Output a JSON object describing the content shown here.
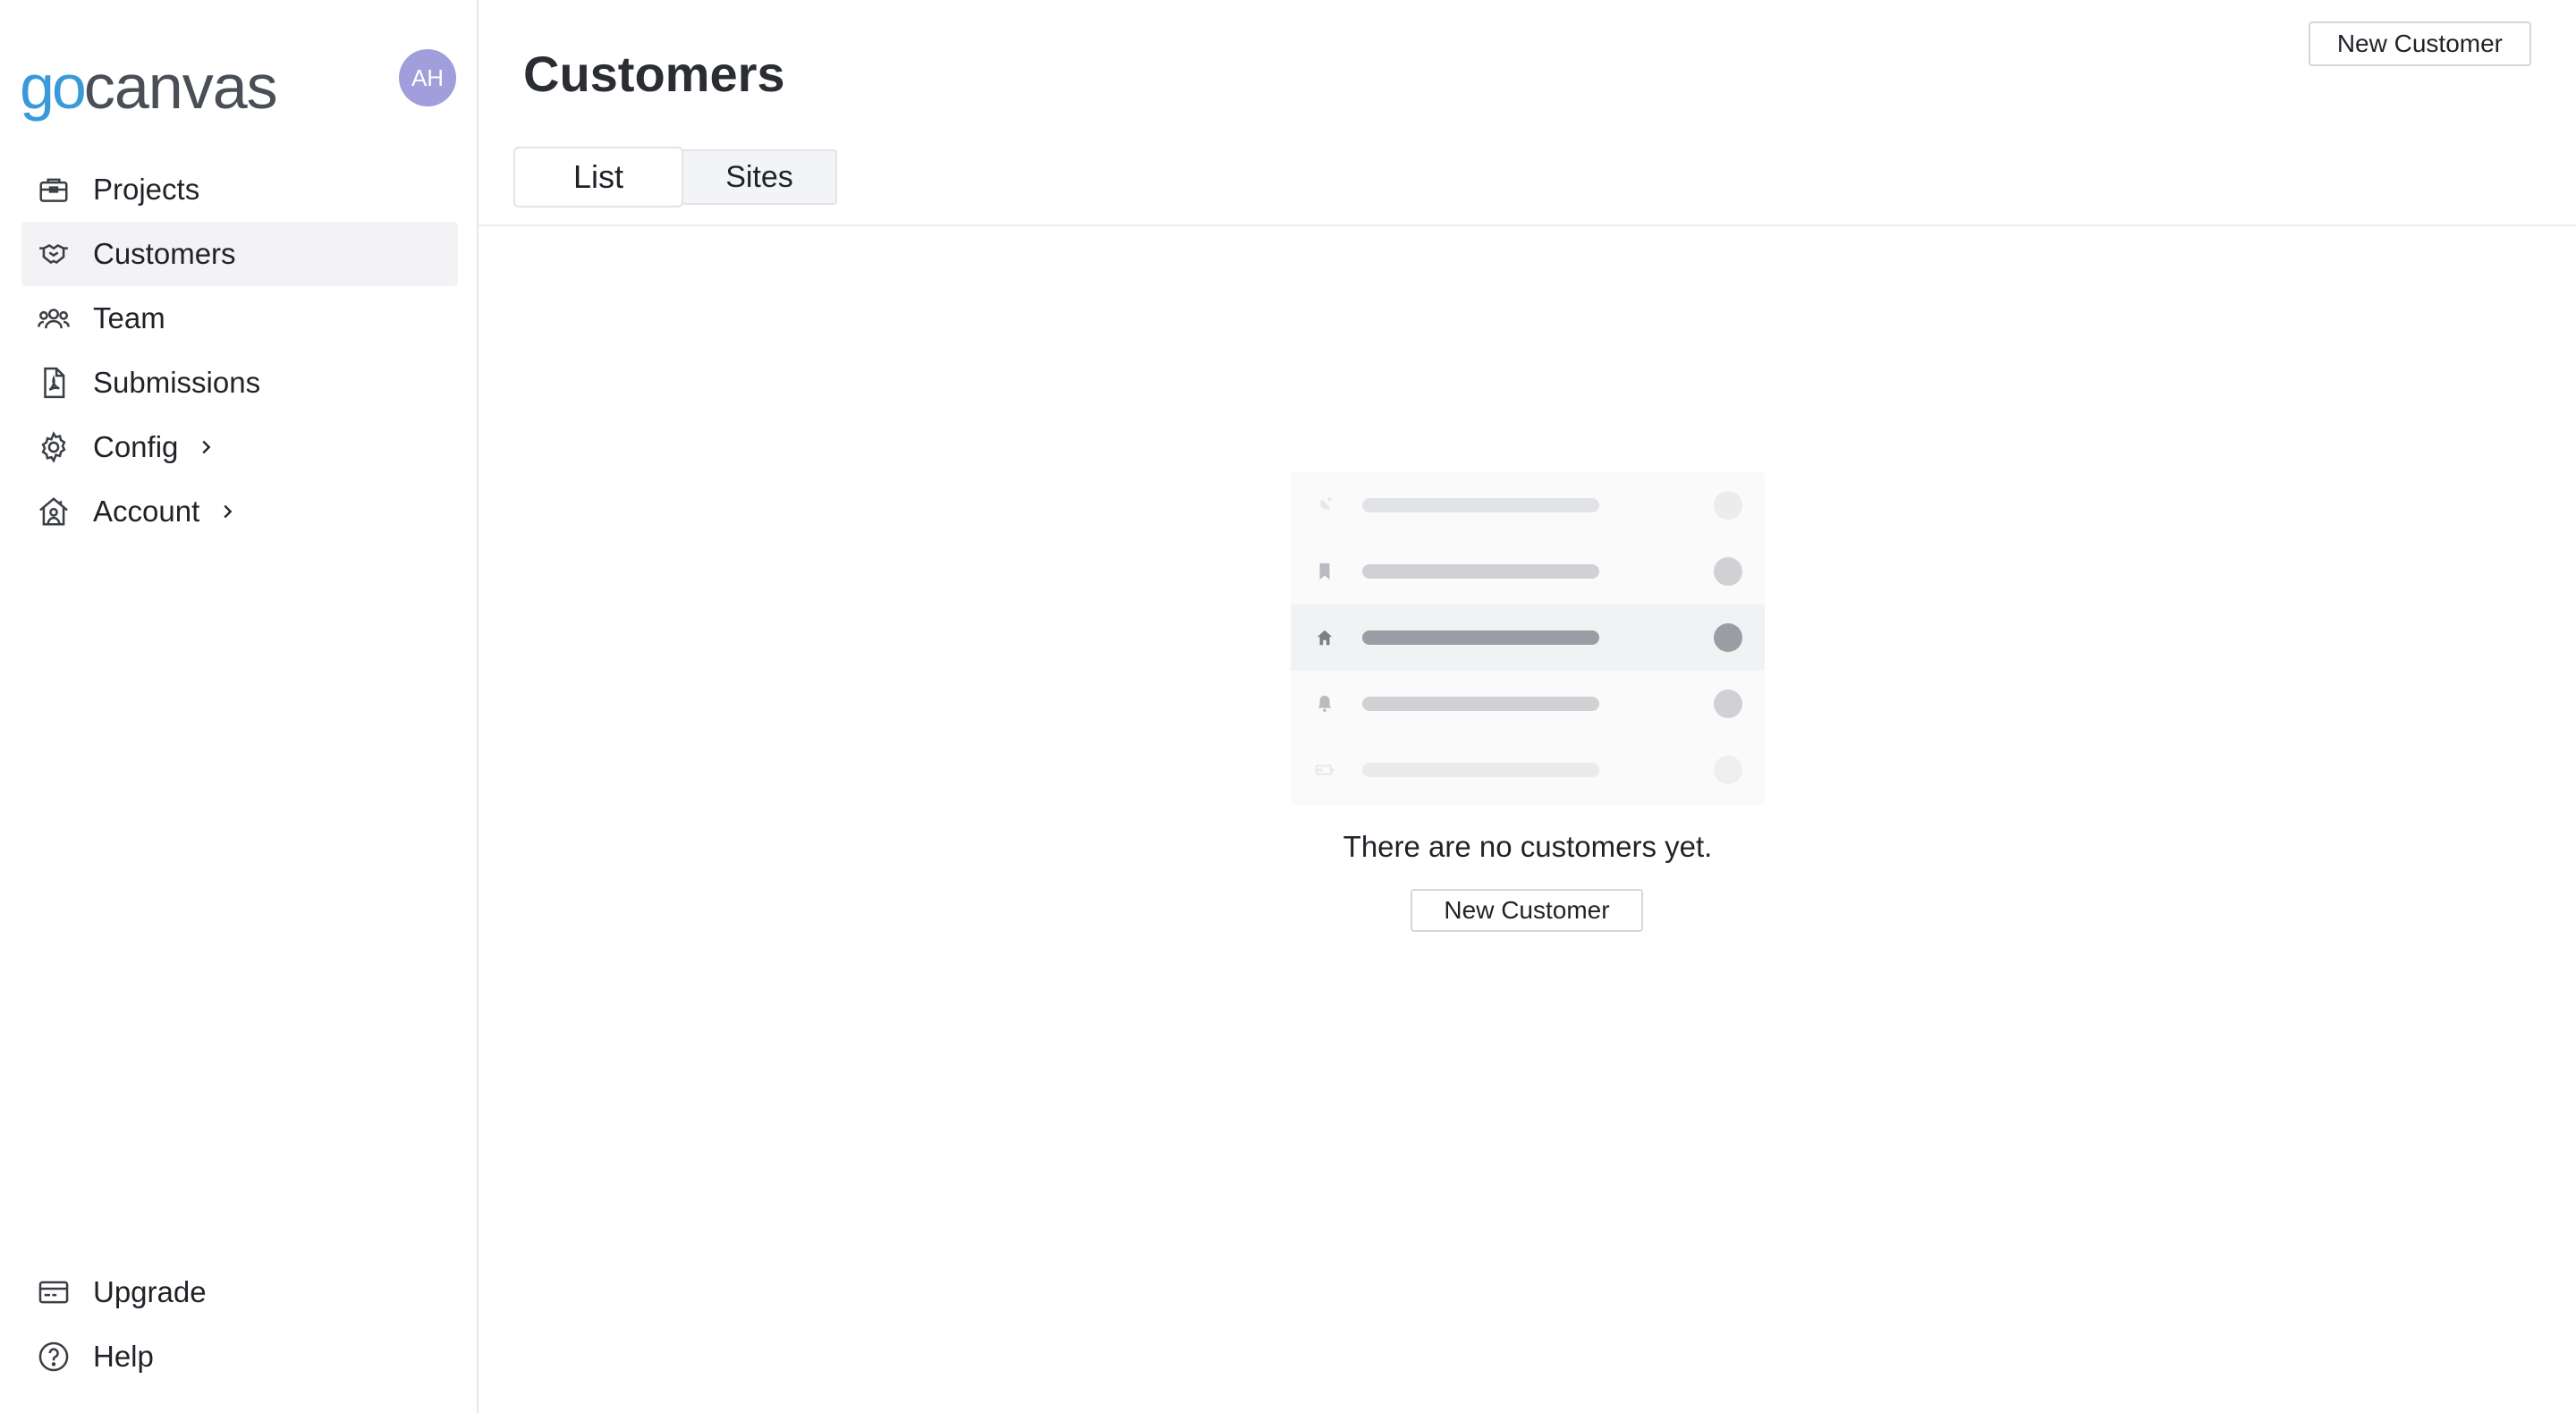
{
  "brand": {
    "go": "go",
    "canvas": "canvas"
  },
  "user": {
    "initials": "AH",
    "avatar_color": "#a09fdc"
  },
  "sidebar": {
    "items": [
      {
        "label": "Projects",
        "icon": "briefcase-icon",
        "active": false
      },
      {
        "label": "Customers",
        "icon": "handshake-icon",
        "active": true
      },
      {
        "label": "Team",
        "icon": "team-icon",
        "active": false
      },
      {
        "label": "Submissions",
        "icon": "pdf-document-icon",
        "active": false
      },
      {
        "label": "Config",
        "icon": "gear-icon",
        "active": false,
        "has_chevron": true
      },
      {
        "label": "Account",
        "icon": "house-user-icon",
        "active": false,
        "has_chevron": true
      }
    ],
    "bottom_items": [
      {
        "label": "Upgrade",
        "icon": "credit-card-icon"
      },
      {
        "label": "Help",
        "icon": "help-circle-icon"
      }
    ]
  },
  "header": {
    "title": "Customers",
    "new_button": "New Customer"
  },
  "tabs": [
    {
      "label": "List",
      "active": true
    },
    {
      "label": "Sites",
      "active": false
    }
  ],
  "empty_state": {
    "message": "There are no customers yet.",
    "button": "New Customer",
    "illustration_icons": [
      "satellite-dish-icon",
      "bookmark-icon",
      "home-icon",
      "bell-icon",
      "battery-icon"
    ]
  },
  "colors": {
    "brand_blue": "#3a9ad9",
    "active_nav_bg": "#f3f3f5"
  }
}
